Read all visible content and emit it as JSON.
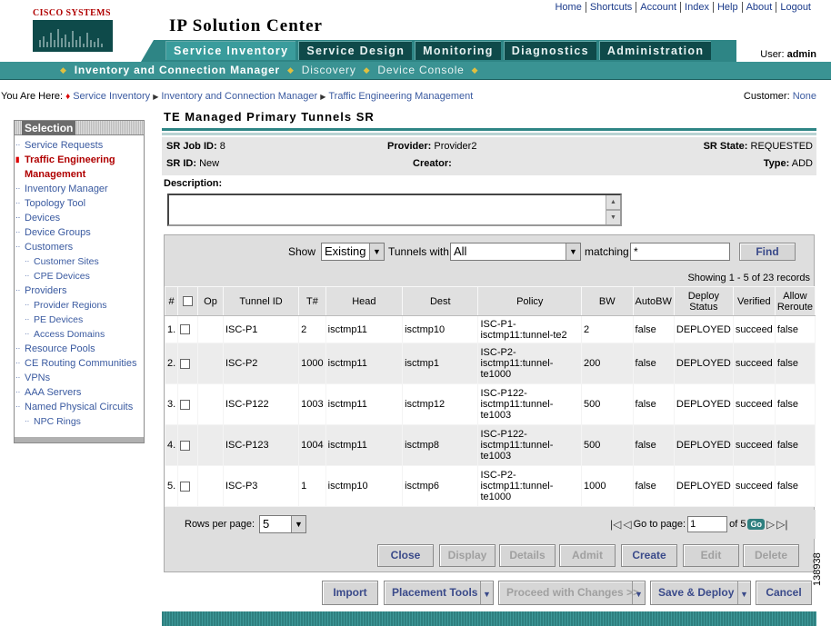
{
  "brand": {
    "logo_text": "CISCO SYSTEMS",
    "app_title": "IP Solution Center"
  },
  "top_links": [
    "Home",
    "Shortcuts",
    "Account",
    "Index",
    "Help",
    "About",
    "Logout"
  ],
  "user": {
    "label": "User:",
    "name": "admin"
  },
  "tabs": [
    {
      "label": "Service Inventory",
      "active": true
    },
    {
      "label": "Service Design",
      "active": false
    },
    {
      "label": "Monitoring",
      "active": false
    },
    {
      "label": "Diagnostics",
      "active": false
    },
    {
      "label": "Administration",
      "active": false
    }
  ],
  "subnav": [
    {
      "label": "Inventory and Connection Manager",
      "active": true
    },
    {
      "label": "Discovery",
      "active": false
    },
    {
      "label": "Device Console",
      "active": false
    }
  ],
  "breadcrumb": {
    "prefix": "You Are Here:",
    "items": [
      "Service Inventory",
      "Inventory and Connection Manager",
      "Traffic Engineering Management"
    ]
  },
  "customer": {
    "label": "Customer:",
    "value": "None"
  },
  "sidebar": {
    "title": "Selection",
    "items": [
      {
        "label": "Service Requests",
        "level": 0
      },
      {
        "label": "Traffic Engineering Management",
        "level": 0,
        "active": true
      },
      {
        "label": "Inventory Manager",
        "level": 0
      },
      {
        "label": "Topology Tool",
        "level": 0
      },
      {
        "label": "",
        "level": 0
      },
      {
        "label": "Devices",
        "level": 0
      },
      {
        "label": "Device Groups",
        "level": 0
      },
      {
        "label": "Customers",
        "level": 0
      },
      {
        "label": "Customer Sites",
        "level": 1
      },
      {
        "label": "CPE Devices",
        "level": 1
      },
      {
        "label": "Providers",
        "level": 0
      },
      {
        "label": "Provider Regions",
        "level": 1
      },
      {
        "label": "PE Devices",
        "level": 1
      },
      {
        "label": "Access Domains",
        "level": 1
      },
      {
        "label": "Resource Pools",
        "level": 0
      },
      {
        "label": "CE Routing Communities",
        "level": 0
      },
      {
        "label": "VPNs",
        "level": 0
      },
      {
        "label": "AAA Servers",
        "level": 0
      },
      {
        "label": "Named Physical Circuits",
        "level": 0
      },
      {
        "label": "NPC Rings",
        "level": 1
      }
    ]
  },
  "page": {
    "title": "TE Managed Primary Tunnels SR"
  },
  "info": {
    "sr_job_id_label": "SR Job ID:",
    "sr_job_id": "8",
    "provider_label": "Provider:",
    "provider": "Provider2",
    "sr_state_label": "SR State:",
    "sr_state": "REQUESTED",
    "sr_id_label": "SR ID:",
    "sr_id": "New",
    "creator_label": "Creator:",
    "creator": "",
    "type_label": "Type:",
    "type": "ADD",
    "description_label": "Description:"
  },
  "filter": {
    "show_label": "Show",
    "show_value": "Existing",
    "tunnels_label": "Tunnels with",
    "tunnels_value": "All",
    "matching_label": "matching",
    "matching_value": "*",
    "find_label": "Find"
  },
  "showing": "Showing 1 - 5 of 23 records",
  "table": {
    "headers": [
      "#",
      "",
      "Op",
      "Tunnel ID",
      "T#",
      "Head",
      "Dest",
      "Policy",
      "BW",
      "AutoBW",
      "Deploy Status",
      "Verified",
      "Allow Reroute"
    ],
    "rows": [
      {
        "num": "1.",
        "op": "",
        "tunnel_id": "ISC-P1",
        "t": "2",
        "head": "isctmp11",
        "dest": "isctmp10",
        "policy": "ISC-P1-isctmp11:tunnel-te2",
        "bw": "2",
        "autobw": "false",
        "status": "DEPLOYED",
        "verified": "succeed",
        "reroute": "false"
      },
      {
        "num": "2.",
        "op": "",
        "tunnel_id": "ISC-P2",
        "t": "1000",
        "head": "isctmp11",
        "dest": "isctmp1",
        "policy": "ISC-P2-isctmp11:tunnel-te1000",
        "bw": "200",
        "autobw": "false",
        "status": "DEPLOYED",
        "verified": "succeed",
        "reroute": "false"
      },
      {
        "num": "3.",
        "op": "",
        "tunnel_id": "ISC-P122",
        "t": "1003",
        "head": "isctmp11",
        "dest": "isctmp12",
        "policy": "ISC-P122-isctmp11:tunnel-te1003",
        "bw": "500",
        "autobw": "false",
        "status": "DEPLOYED",
        "verified": "succeed",
        "reroute": "false"
      },
      {
        "num": "4.",
        "op": "",
        "tunnel_id": "ISC-P123",
        "t": "1004",
        "head": "isctmp11",
        "dest": "isctmp8",
        "policy": "ISC-P122-isctmp11:tunnel-te1003",
        "bw": "500",
        "autobw": "false",
        "status": "DEPLOYED",
        "verified": "succeed",
        "reroute": "false"
      },
      {
        "num": "5.",
        "op": "",
        "tunnel_id": "ISC-P3",
        "t": "1",
        "head": "isctmp10",
        "dest": "isctmp6",
        "policy": "ISC-P2-isctmp11:tunnel-te1000",
        "bw": "1000",
        "autobw": "false",
        "status": "DEPLOYED",
        "verified": "succeed",
        "reroute": "false"
      }
    ]
  },
  "pager": {
    "rows_label": "Rows per page:",
    "rows_value": "5",
    "goto_label": "Go to page:",
    "goto_value": "1",
    "of_label": "of 5",
    "go_label": "Go"
  },
  "actions": [
    {
      "label": "Close",
      "enabled": true
    },
    {
      "label": "Display",
      "enabled": false
    },
    {
      "label": "Details",
      "enabled": false
    },
    {
      "label": "Admit",
      "enabled": false
    },
    {
      "label": "Create",
      "enabled": true
    },
    {
      "label": "Edit",
      "enabled": false
    },
    {
      "label": "Delete",
      "enabled": false
    }
  ],
  "bottom_actions": [
    {
      "label": "Import",
      "enabled": true,
      "dropdown": false
    },
    {
      "label": "Placement Tools",
      "enabled": true,
      "dropdown": true
    },
    {
      "label": "Proceed with Changes >>",
      "enabled": false,
      "dropdown": true
    },
    {
      "label": "Save & Deploy",
      "enabled": true,
      "dropdown": true
    },
    {
      "label": "Cancel",
      "enabled": true,
      "dropdown": false
    }
  ],
  "figure_number": "138938"
}
